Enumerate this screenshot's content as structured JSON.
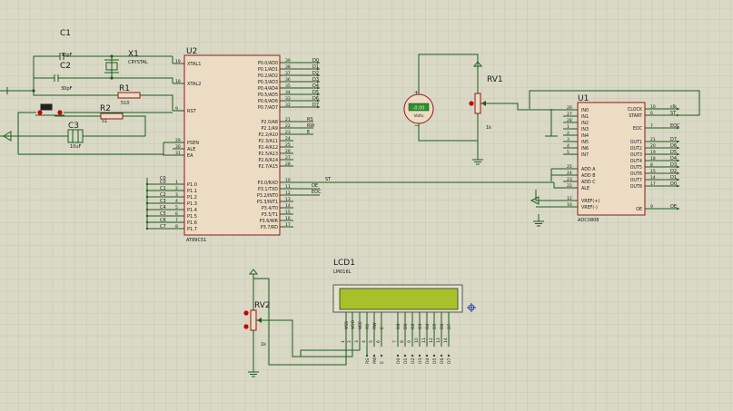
{
  "colors": {
    "background": "#d9d9c6",
    "grid": "#c9c9b5",
    "wire": "#1d5c1d",
    "chip_border": "#8a1a1a",
    "chip_fill": "#ecdcc4",
    "label": "#1a1a1a",
    "pin_dot": "#cc0000",
    "lcd_screen": "#a8c12a",
    "voltmeter_display": "#2f8f2f"
  },
  "u2": {
    "ref": "U2",
    "part": "AT89C51",
    "left_pins": [
      {
        "name": "XTAL1",
        "num": "19"
      },
      {
        "name": "XTAL2",
        "num": "18"
      },
      {
        "name": "RST",
        "num": "9"
      },
      {
        "name": "PSEN",
        "num": "29"
      },
      {
        "name": "ALE",
        "num": "30"
      },
      {
        "name": "EA",
        "num": "31"
      },
      {
        "name": "P1.0",
        "num": "1"
      },
      {
        "name": "P1.1",
        "num": "2"
      },
      {
        "name": "P1.2",
        "num": "3"
      },
      {
        "name": "P1.3",
        "num": "4"
      },
      {
        "name": "P1.4",
        "num": "5"
      },
      {
        "name": "P1.5",
        "num": "6"
      },
      {
        "name": "P1.6",
        "num": "7"
      },
      {
        "name": "P1.7",
        "num": "8"
      }
    ],
    "right_pins": [
      {
        "name": "P0.0/AD0",
        "num": "39"
      },
      {
        "name": "P0.1/AD1",
        "num": "38"
      },
      {
        "name": "P0.2/AD2",
        "num": "37"
      },
      {
        "name": "P0.3/AD3",
        "num": "36"
      },
      {
        "name": "P0.4/AD4",
        "num": "35"
      },
      {
        "name": "P0.5/AD5",
        "num": "34"
      },
      {
        "name": "P0.6/AD6",
        "num": "33"
      },
      {
        "name": "P0.7/AD7",
        "num": "32"
      },
      {
        "name": "P2.0/A8",
        "num": "21"
      },
      {
        "name": "P2.1/A9",
        "num": "22"
      },
      {
        "name": "P2.2/A10",
        "num": "23"
      },
      {
        "name": "P2.3/A11",
        "num": "24"
      },
      {
        "name": "P2.4/A12",
        "num": "25"
      },
      {
        "name": "P2.5/A13",
        "num": "26"
      },
      {
        "name": "P2.6/A14",
        "num": "27"
      },
      {
        "name": "P2.7/A15",
        "num": "28"
      },
      {
        "name": "P3.0/RXD",
        "num": "10"
      },
      {
        "name": "P3.1/TXD",
        "num": "11"
      },
      {
        "name": "P3.2/INT0",
        "num": "12"
      },
      {
        "name": "P3.3/INT1",
        "num": "13"
      },
      {
        "name": "P3.4/T0",
        "num": "14"
      },
      {
        "name": "P3.5/T1",
        "num": "15"
      },
      {
        "name": "P3.6/WR",
        "num": "16"
      },
      {
        "name": "P3.7/RD",
        "num": "17"
      }
    ],
    "p0_net_labels": [
      "D0",
      "D1",
      "D2",
      "D3",
      "D4",
      "D5",
      "D6",
      "D7"
    ],
    "p2_net_labels": [
      "RS",
      "RW",
      "E"
    ],
    "p3_net_labels": [
      "ST",
      "OE",
      "EOC"
    ],
    "p1_net_labels": [
      "C0",
      "C1",
      "C2",
      "C3",
      "C4",
      "C5",
      "C6",
      "C7"
    ]
  },
  "u1": {
    "ref": "U1",
    "part": "ADC0808",
    "left_pins": [
      {
        "name": "IN0",
        "num": "26"
      },
      {
        "name": "IN1",
        "num": "27"
      },
      {
        "name": "IN2",
        "num": "28"
      },
      {
        "name": "IN3",
        "num": "1"
      },
      {
        "name": "IN4",
        "num": "2"
      },
      {
        "name": "IN5",
        "num": "3"
      },
      {
        "name": "IN6",
        "num": "4"
      },
      {
        "name": "IN7",
        "num": "5"
      },
      {
        "name": "ADD A",
        "num": "25"
      },
      {
        "name": "ADD B",
        "num": "24"
      },
      {
        "name": "ADD C",
        "num": "23"
      },
      {
        "name": "ALE",
        "num": "22"
      },
      {
        "name": "VREF(+)",
        "num": "12"
      },
      {
        "name": "VREF(-)",
        "num": "16"
      }
    ],
    "right_pins": [
      {
        "name": "CLOCK",
        "num": "10"
      },
      {
        "name": "START",
        "num": "6"
      },
      {
        "name": "EOC",
        "num": "7"
      },
      {
        "name": "OUT1",
        "num": "21"
      },
      {
        "name": "OUT2",
        "num": "20"
      },
      {
        "name": "OUT3",
        "num": "19"
      },
      {
        "name": "OUT4",
        "num": "18"
      },
      {
        "name": "OUT5",
        "num": "8"
      },
      {
        "name": "OUT6",
        "num": "15"
      },
      {
        "name": "OUT7",
        "num": "14"
      },
      {
        "name": "OUT8",
        "num": "17"
      },
      {
        "name": "OE",
        "num": "9"
      }
    ],
    "right_net_labels": [
      "clk",
      "ST",
      "EOC",
      "D7",
      "D6",
      "D5",
      "D4",
      "D3",
      "D2",
      "D1",
      "D0",
      "OE"
    ]
  },
  "components": {
    "c1": {
      "ref": "C1",
      "value": "30pF"
    },
    "c2": {
      "ref": "C2",
      "value": "30pF"
    },
    "x1": {
      "ref": "X1",
      "value": "CRYSTAL"
    },
    "r1": {
      "ref": "R1",
      "value": "510"
    },
    "r2": {
      "ref": "R2",
      "value": "51"
    },
    "c3": {
      "ref": "C3",
      "value": "10uF"
    },
    "rv1": {
      "ref": "RV1",
      "value": "1k"
    },
    "rv2": {
      "ref": "RV2",
      "value": "1k"
    },
    "voltmeter": {
      "display": "-0.00",
      "unit": "Volts"
    }
  },
  "lcd": {
    "ref": "LCD1",
    "part": "LM016L",
    "pin_names": [
      "VSS",
      "VDD",
      "VEE",
      "RS",
      "RW",
      "E",
      "D0",
      "D1",
      "D2",
      "D3",
      "D4",
      "D5",
      "D6",
      "D7"
    ],
    "pin_nums": [
      "1",
      "2",
      "3",
      "4",
      "5",
      "6",
      "7",
      "8",
      "9",
      "10",
      "11",
      "12",
      "13",
      "14"
    ],
    "net_labels": [
      "RS",
      "RW",
      "E",
      "D0",
      "D1",
      "D2",
      "D3",
      "D4",
      "D5",
      "D6",
      "D7"
    ]
  }
}
